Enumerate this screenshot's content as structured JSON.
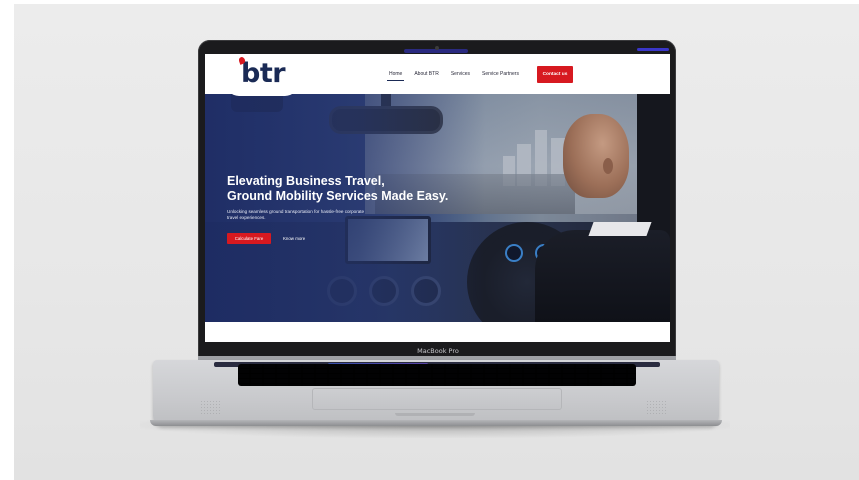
{
  "site": {
    "logo_text": "btr",
    "nav": {
      "items": [
        {
          "label": "Home",
          "active": true
        },
        {
          "label": "About BTR",
          "active": false
        },
        {
          "label": "Services",
          "active": false
        },
        {
          "label": "Service Partners",
          "active": false
        }
      ],
      "contact_label": "Contact us"
    },
    "hero": {
      "title_line1": "Elevating Business Travel,",
      "title_line2": "Ground Mobility Services Made Easy.",
      "subtitle": "Unlocking seamless ground transportation for hassle-free corporate travel experiences.",
      "primary_cta": "Calculate Fare",
      "secondary_cta": "Know more"
    }
  },
  "device": {
    "model_label": "MacBook Pro"
  },
  "colors": {
    "brand_red": "#d71920",
    "brand_navy": "#1a2a55",
    "hero_blue": "#2a3c74",
    "background": "#e9e9e9"
  }
}
